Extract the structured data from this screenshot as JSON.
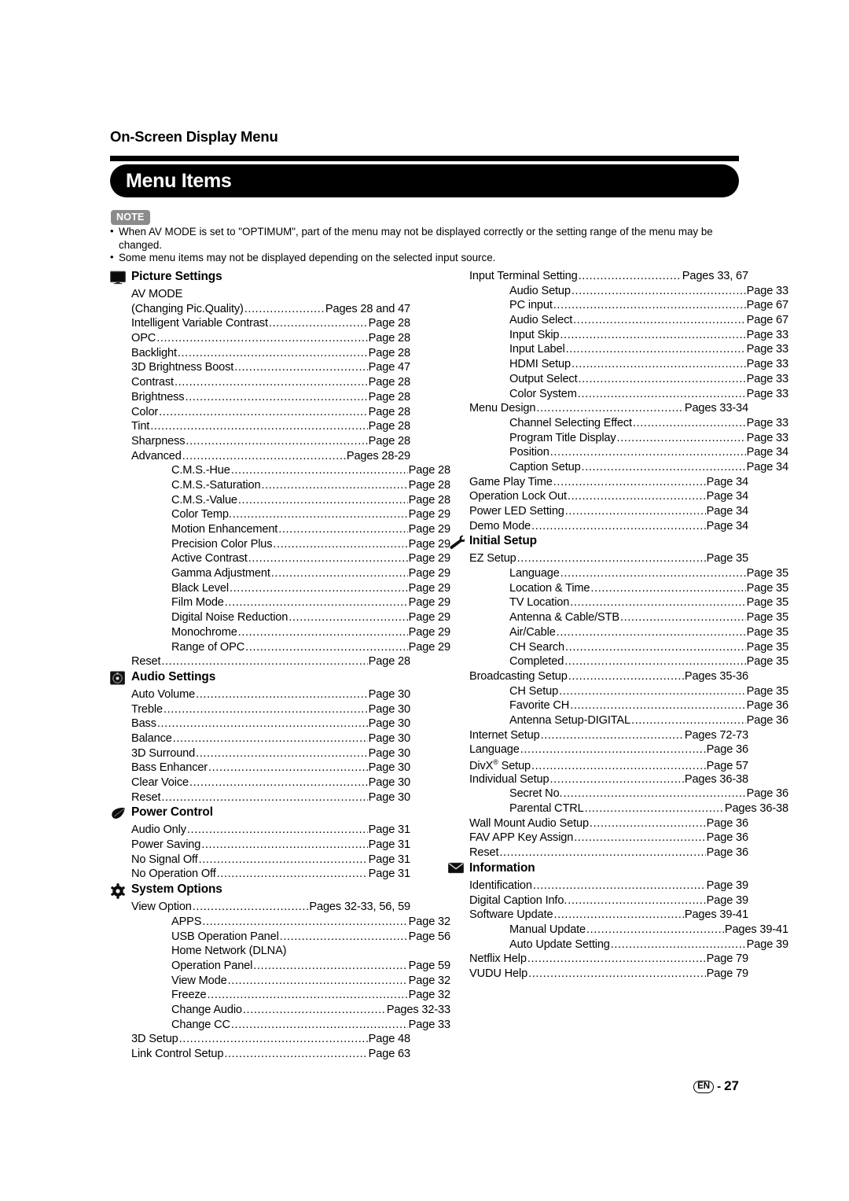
{
  "header": {
    "running_head": "On-Screen Display Menu",
    "title": "Menu Items"
  },
  "note": {
    "badge": "NOTE",
    "bullet": "•",
    "items": [
      "When AV MODE is set to \"OPTIMUM\", part of the menu may not be displayed correctly or the setting range of the menu may be changed.",
      "Some menu items may not be displayed depending on the selected input source."
    ]
  },
  "leader_char": ".",
  "columns": {
    "left": [
      {
        "icon": "tv-monitor-icon",
        "title": "Picture Settings",
        "rows": [
          {
            "label": "AV MODE",
            "page": "",
            "indent": 0
          },
          {
            "label": "(Changing Pic.Quality)",
            "page": "Pages 28 and 47",
            "indent": 0
          },
          {
            "label": "Intelligent Variable Contrast",
            "page": "Page 28",
            "indent": 0
          },
          {
            "label": "OPC",
            "page": "Page 28",
            "indent": 0
          },
          {
            "label": "Backlight",
            "page": "Page 28",
            "indent": 0
          },
          {
            "label": "3D Brightness Boost",
            "page": "Page 47",
            "indent": 0
          },
          {
            "label": "Contrast",
            "page": "Page 28",
            "indent": 0
          },
          {
            "label": "Brightness",
            "page": "Page 28",
            "indent": 0
          },
          {
            "label": "Color",
            "page": "Page 28",
            "indent": 0
          },
          {
            "label": "Tint",
            "page": "Page 28",
            "indent": 0
          },
          {
            "label": "Sharpness",
            "page": "Page 28",
            "indent": 0
          },
          {
            "label": "Advanced",
            "page": "Pages 28-29",
            "indent": 0
          },
          {
            "label": "C.M.S.-Hue",
            "page": "Page 28",
            "indent": 2
          },
          {
            "label": "C.M.S.-Saturation",
            "page": "Page 28",
            "indent": 2
          },
          {
            "label": "C.M.S.-Value",
            "page": "Page 28",
            "indent": 2
          },
          {
            "label": "Color Temp. ",
            "page": "Page 29",
            "indent": 2
          },
          {
            "label": "Motion Enhancement",
            "page": "Page 29",
            "indent": 2
          },
          {
            "label": "Precision Color Plus",
            "page": "Page 29",
            "indent": 2
          },
          {
            "label": "Active Contrast",
            "page": "Page 29",
            "indent": 2
          },
          {
            "label": "Gamma Adjustment",
            "page": "Page 29",
            "indent": 2
          },
          {
            "label": "Black Level",
            "page": "Page 29",
            "indent": 2
          },
          {
            "label": "Film Mode",
            "page": "Page 29",
            "indent": 2
          },
          {
            "label": "Digital Noise Reduction",
            "page": "Page 29",
            "indent": 2
          },
          {
            "label": "Monochrome",
            "page": "Page 29",
            "indent": 2
          },
          {
            "label": "Range of OPC",
            "page": "Page 29",
            "indent": 2
          },
          {
            "label": "Reset",
            "page": "Page 28",
            "indent": 0
          }
        ]
      },
      {
        "icon": "speaker-icon",
        "title": "Audio Settings",
        "rows": [
          {
            "label": "Auto Volume",
            "page": "Page 30",
            "indent": 0
          },
          {
            "label": "Treble",
            "page": "Page 30",
            "indent": 0
          },
          {
            "label": "Bass",
            "page": "Page 30",
            "indent": 0
          },
          {
            "label": "Balance",
            "page": "Page 30",
            "indent": 0
          },
          {
            "label": "3D Surround",
            "page": "Page 30",
            "indent": 0
          },
          {
            "label": "Bass Enhancer",
            "page": "Page 30",
            "indent": 0
          },
          {
            "label": "Clear Voice",
            "page": "Page 30",
            "indent": 0
          },
          {
            "label": "Reset",
            "page": "Page 30",
            "indent": 0
          }
        ]
      },
      {
        "icon": "leaf-icon",
        "title": "Power Control",
        "rows": [
          {
            "label": "Audio Only",
            "page": "Page 31",
            "indent": 0
          },
          {
            "label": "Power Saving",
            "page": "Page 31",
            "indent": 0
          },
          {
            "label": "No Signal Off",
            "page": "Page 31",
            "indent": 0
          },
          {
            "label": "No Operation Off",
            "page": "Page 31",
            "indent": 0
          }
        ]
      },
      {
        "icon": "gear-icon",
        "title": "System Options",
        "rows": [
          {
            "label": "View Option",
            "page": "Pages 32-33, 56, 59",
            "indent": 0
          },
          {
            "label": "APPS",
            "page": "Page 32",
            "indent": 2
          },
          {
            "label": "USB Operation Panel",
            "page": "Page 56",
            "indent": 2
          },
          {
            "label": "Home Network (DLNA)",
            "page": "",
            "indent": 2
          },
          {
            "label": "Operation Panel",
            "page": "Page 59",
            "indent": 2
          },
          {
            "label": "View Mode",
            "page": "Page 32",
            "indent": 2
          },
          {
            "label": "Freeze",
            "page": "Page 32",
            "indent": 2
          },
          {
            "label": "Change Audio",
            "page": "Pages 32-33",
            "indent": 2
          },
          {
            "label": "Change CC",
            "page": "Page 33",
            "indent": 2
          },
          {
            "label": "3D Setup",
            "page": "Page 48",
            "indent": 0
          },
          {
            "label": "Link Control Setup",
            "page": "Page 63",
            "indent": 0
          }
        ]
      }
    ],
    "right": [
      {
        "icon": "",
        "title": "",
        "rows": [
          {
            "label": "Input Terminal Setting",
            "page": "Pages 33, 67",
            "indent": 0
          },
          {
            "label": "Audio Setup",
            "page": "Page 33",
            "indent": 2
          },
          {
            "label": "PC input",
            "page": "Page 67",
            "indent": 2
          },
          {
            "label": "Audio Select",
            "page": "Page 67",
            "indent": 2
          },
          {
            "label": "Input Skip",
            "page": "Page 33",
            "indent": 2
          },
          {
            "label": "Input Label",
            "page": "Page 33",
            "indent": 2
          },
          {
            "label": "HDMI Setup",
            "page": "Page 33",
            "indent": 2
          },
          {
            "label": "Output Select",
            "page": "Page 33",
            "indent": 2
          },
          {
            "label": "Color System",
            "page": "Page 33",
            "indent": 2
          },
          {
            "label": "Menu Design",
            "page": "Pages 33-34",
            "indent": 0
          },
          {
            "label": "Channel Selecting Effect",
            "page": "Page 33",
            "indent": 2
          },
          {
            "label": "Program Title Display",
            "page": "Page 33",
            "indent": 2
          },
          {
            "label": "Position",
            "page": "Page 34",
            "indent": 2
          },
          {
            "label": "Caption Setup",
            "page": "Page 34",
            "indent": 2
          },
          {
            "label": "Game Play Time",
            "page": "Page 34",
            "indent": 0
          },
          {
            "label": "Operation Lock Out",
            "page": "Page 34",
            "indent": 0
          },
          {
            "label": "Power LED Setting",
            "page": "Page 34",
            "indent": 0
          },
          {
            "label": "Demo Mode",
            "page": "Page 34",
            "indent": 0
          }
        ]
      },
      {
        "icon": "wrench-icon",
        "title": "Initial Setup",
        "rows": [
          {
            "label": "EZ Setup",
            "page": "Page 35",
            "indent": 0
          },
          {
            "label": "Language",
            "page": "Page 35",
            "indent": 2
          },
          {
            "label": "Location & Time",
            "page": "Page 35",
            "indent": 2
          },
          {
            "label": "TV Location",
            "page": "Page 35",
            "indent": 2
          },
          {
            "label": "Antenna & Cable/STB",
            "page": "Page 35",
            "indent": 2
          },
          {
            "label": "Air/Cable",
            "page": "Page 35",
            "indent": 2
          },
          {
            "label": "CH Search",
            "page": "Page 35",
            "indent": 2
          },
          {
            "label": "Completed",
            "page": "Page 35",
            "indent": 2
          },
          {
            "label": "Broadcasting Setup",
            "page": "Pages 35-36",
            "indent": 0
          },
          {
            "label": "CH Setup",
            "page": "Page 35",
            "indent": 2
          },
          {
            "label": "Favorite CH",
            "page": "Page 36",
            "indent": 2
          },
          {
            "label": "Antenna Setup-DIGITAL",
            "page": "Page 36",
            "indent": 2
          },
          {
            "label": "Internet Setup",
            "page": "Pages 72-73",
            "indent": 0
          },
          {
            "label": "Language",
            "page": "Page 36",
            "indent": 0
          },
          {
            "label": "DivX® Setup",
            "page": "Page 57",
            "indent": 0,
            "sup": "®",
            "base": "DivX",
            "tail": " Setup"
          },
          {
            "label": "Individual Setup",
            "page": "Pages 36-38",
            "indent": 0
          },
          {
            "label": "Secret No. ",
            "page": "Page 36",
            "indent": 2
          },
          {
            "label": "Parental CTRL",
            "page": "Pages 36-38",
            "indent": 2
          },
          {
            "label": "Wall Mount Audio Setup",
            "page": "Page 36",
            "indent": 0
          },
          {
            "label": "FAV APP Key Assign",
            "page": "Page 36",
            "indent": 0
          },
          {
            "label": "Reset",
            "page": "Page 36",
            "indent": 0
          }
        ]
      },
      {
        "icon": "envelope-icon",
        "title": "Information",
        "rows": [
          {
            "label": "Identification",
            "page": "Page 39",
            "indent": 0
          },
          {
            "label": "Digital Caption Info. ",
            "page": "Page 39",
            "indent": 0
          },
          {
            "label": "Software Update",
            "page": "Pages 39-41",
            "indent": 0
          },
          {
            "label": "Manual Update",
            "page": "Pages 39-41",
            "indent": 2
          },
          {
            "label": "Auto Update Setting",
            "page": "Page 39",
            "indent": 2
          },
          {
            "label": "Netflix Help",
            "page": "Page 79",
            "indent": 0
          },
          {
            "label": "VUDU Help",
            "page": "Page 79",
            "indent": 0
          }
        ]
      }
    ]
  },
  "footer": {
    "locale_badge": "EN",
    "dash": "-",
    "page_number": "27"
  }
}
